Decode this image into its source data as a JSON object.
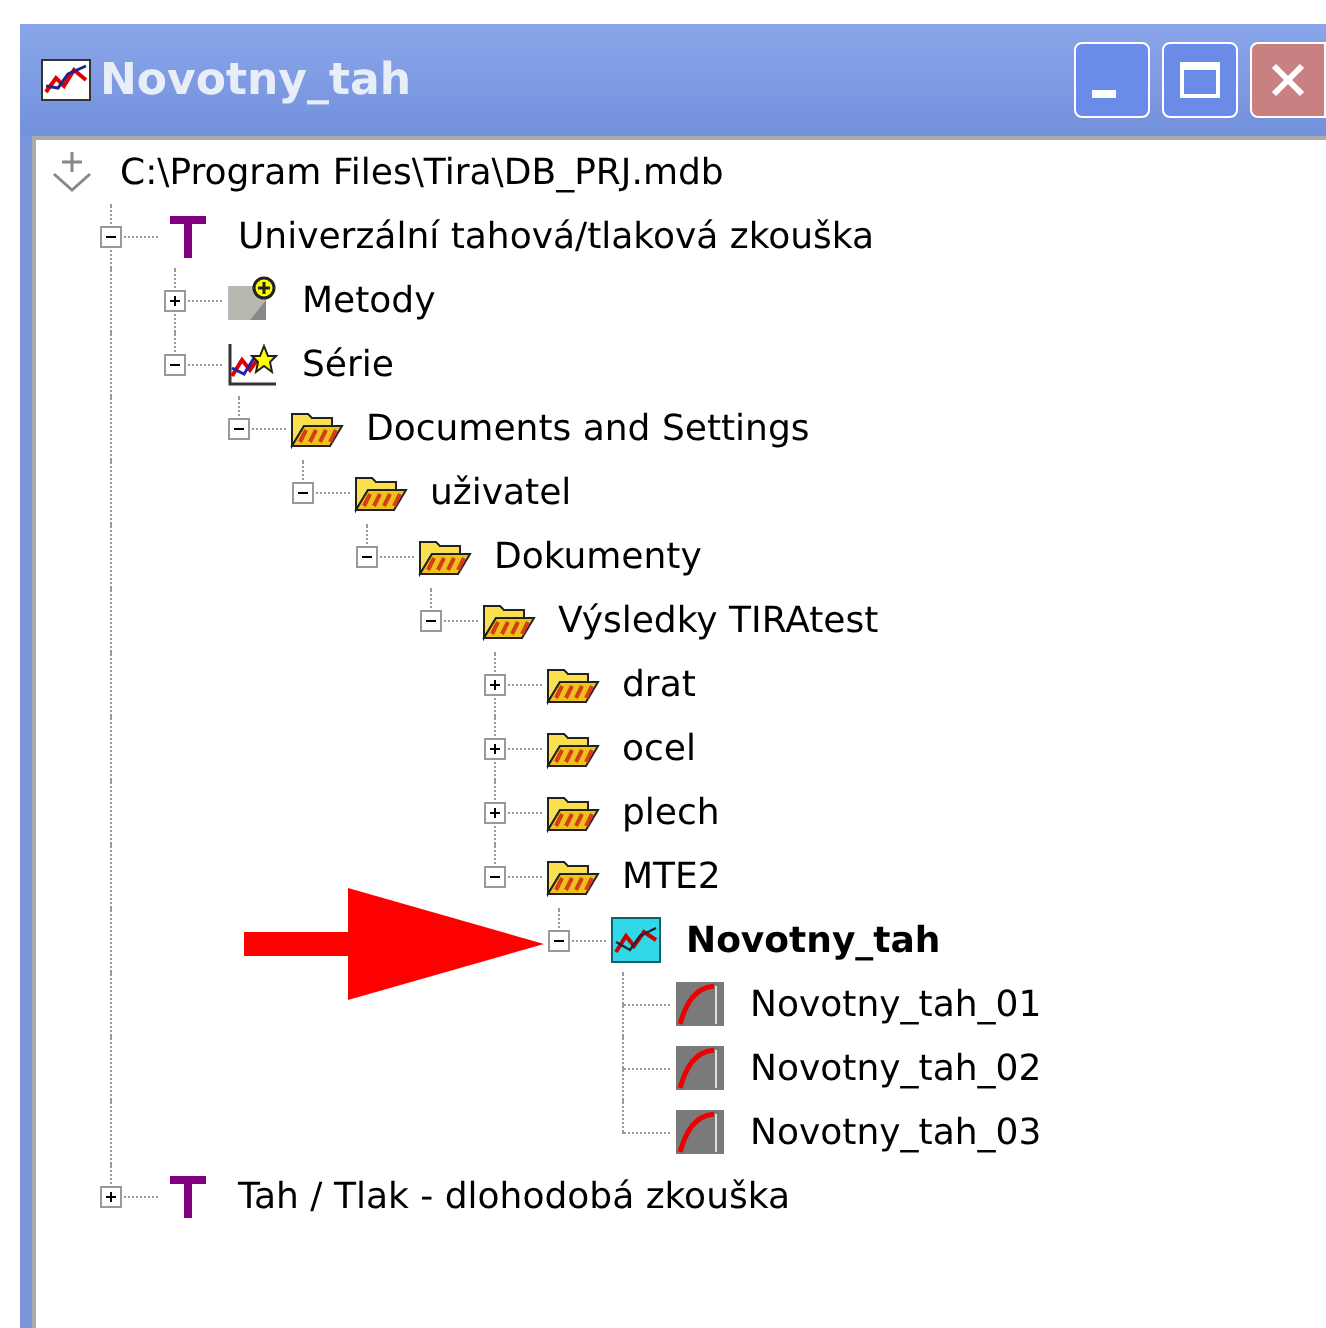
{
  "window": {
    "title": "Novotny_tah"
  },
  "tree": {
    "root": {
      "label": "C:\\Program Files\\Tira\\DB_PRJ.mdb"
    },
    "items": [
      {
        "label": "Univerzální tahová/tlaková zkouška",
        "kind": "test",
        "expanded": true,
        "selected": false,
        "children": [
          {
            "label": "Metody",
            "kind": "methods",
            "expanded": false,
            "selected": false
          },
          {
            "label": "Série",
            "kind": "series",
            "expanded": true,
            "selected": false,
            "children": [
              {
                "label": "Documents and Settings",
                "kind": "folder",
                "expanded": true,
                "selected": false,
                "children": [
                  {
                    "label": "uživatel",
                    "kind": "folder",
                    "expanded": true,
                    "selected": false,
                    "children": [
                      {
                        "label": "Dokumenty",
                        "kind": "folder",
                        "expanded": true,
                        "selected": false,
                        "children": [
                          {
                            "label": "Výsledky TIRAtest",
                            "kind": "folder",
                            "expanded": true,
                            "selected": false,
                            "children": [
                              {
                                "label": "drat",
                                "kind": "folder",
                                "expanded": false,
                                "selected": false
                              },
                              {
                                "label": "ocel",
                                "kind": "folder",
                                "expanded": false,
                                "selected": false
                              },
                              {
                                "label": "plech",
                                "kind": "folder",
                                "expanded": false,
                                "selected": false
                              },
                              {
                                "label": "MTE2",
                                "kind": "folder",
                                "expanded": true,
                                "selected": false,
                                "children": [
                                  {
                                    "label": "Novotny_tah",
                                    "kind": "result",
                                    "expanded": true,
                                    "selected": true,
                                    "children": [
                                      {
                                        "label": "Novotny_tah_01",
                                        "kind": "curve",
                                        "selected": false
                                      },
                                      {
                                        "label": "Novotny_tah_02",
                                        "kind": "curve",
                                        "selected": false
                                      },
                                      {
                                        "label": "Novotny_tah_03",
                                        "kind": "curve",
                                        "selected": false
                                      }
                                    ]
                                  }
                                ]
                              }
                            ]
                          }
                        ]
                      }
                    ]
                  }
                ]
              }
            ]
          }
        ]
      },
      {
        "label": "Tah / Tlak - dlohodobá zkouška",
        "kind": "test",
        "expanded": false,
        "selected": false
      }
    ]
  }
}
